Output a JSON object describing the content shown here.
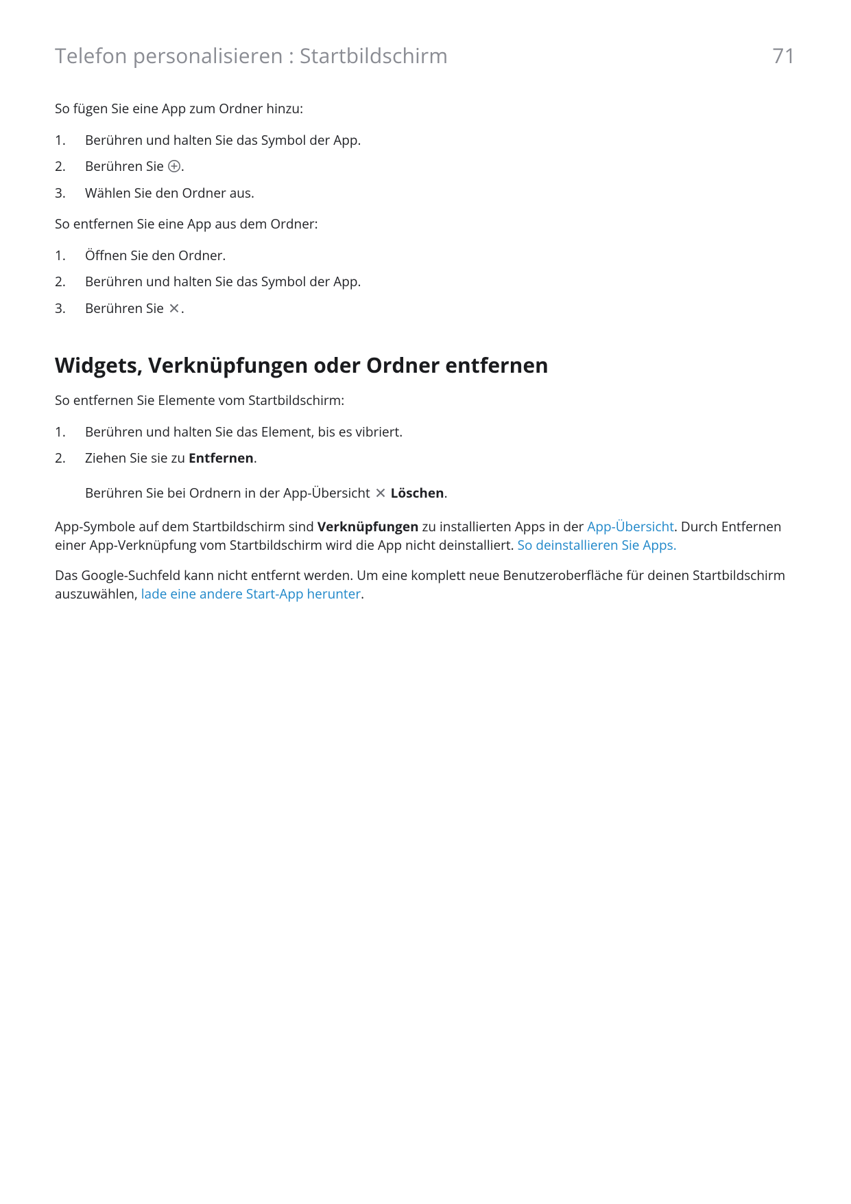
{
  "header": {
    "breadcrumb": "Telefon personalisieren : Startbildschirm",
    "page_number": "71"
  },
  "s_add": {
    "intro": "So fügen Sie eine App zum Ordner hinzu:",
    "i1": "Berühren und halten Sie das Symbol der App.",
    "i2a": "Berühren Sie ",
    "i2c": ".",
    "i3": "Wählen Sie den Ordner aus."
  },
  "s_rem": {
    "intro": "So entfernen Sie eine App aus dem Ordner:",
    "i1": "Öffnen Sie den Ordner.",
    "i2": "Berühren und halten Sie das Symbol der App.",
    "i3a": "Berühren Sie ",
    "i3c": "."
  },
  "h2": "Widgets, Verknüpfungen oder Ordner entfernen",
  "s_widgets": {
    "intro": "So entfernen Sie Elemente vom Startbildschirm:",
    "i1": "Berühren und halten Sie das Element, bis es vibriert.",
    "i2a": "Ziehen Sie sie zu ",
    "i2b": "Entfernen",
    "i2c": ".",
    "note_a": "Berühren Sie bei Ordnern in der App-Übersicht ",
    "note_b": "Löschen",
    "note_c": "."
  },
  "p1": {
    "a": "App-Symbole auf dem Startbildschirm sind ",
    "b": "Verknüpfungen",
    "c": " zu installierten Apps in der ",
    "link1": "App-Übersicht",
    "d": ". Durch Entfernen einer App-Verknüpfung vom Startbildschirm wird die App nicht deinstalliert. ",
    "link2": "So deinstallieren Sie Apps."
  },
  "p2": {
    "a": "Das Google-Suchfeld kann nicht entfernt werden. Um eine komplett neue Benutzeroberfläche für deinen Startbildschirm auszuwählen, ",
    "link": "lade eine andere Start-App herunter",
    "b": "."
  },
  "n": {
    "1": "1.",
    "2": "2.",
    "3": "3."
  }
}
